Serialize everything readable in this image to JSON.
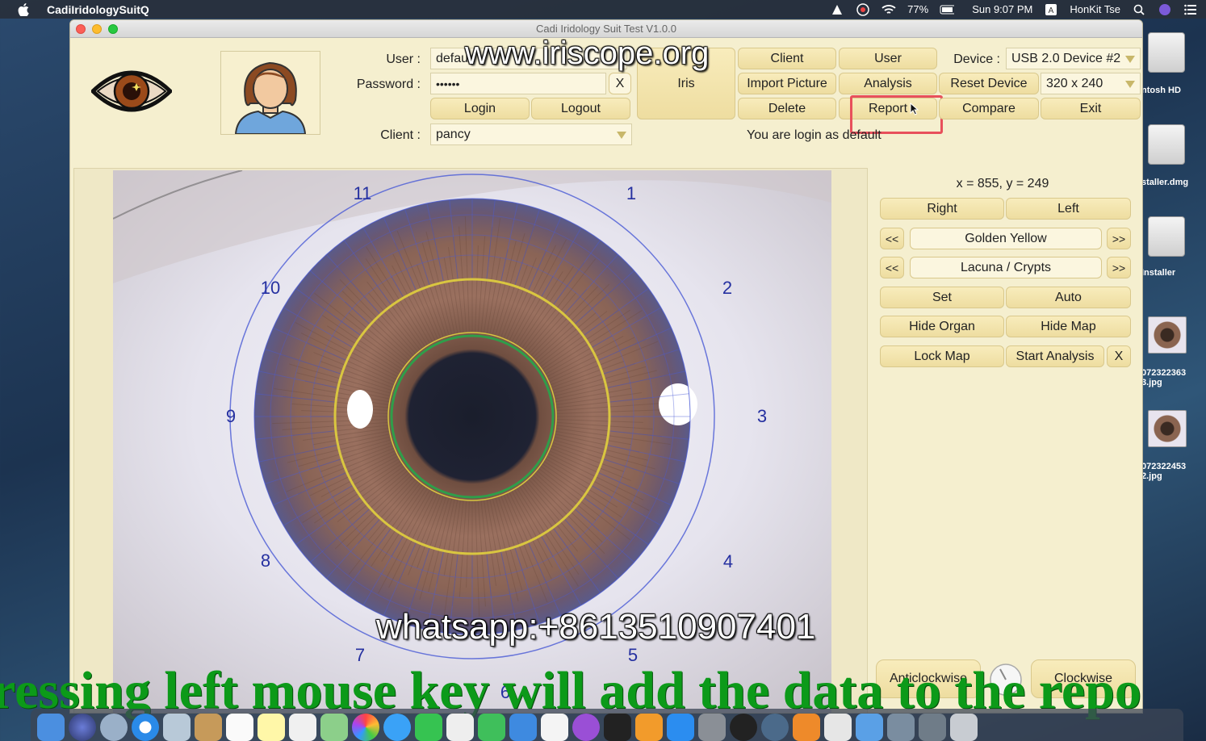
{
  "menubar": {
    "app_name": "CadiIridologySuitQ",
    "battery": "77%",
    "clock": "Sun 9:07 PM",
    "user": "HonKit Tse"
  },
  "desktop": {
    "items": [
      {
        "label": "ntosh HD",
        "icon": "hard-drive-icon"
      },
      {
        "label": "staller.dmg",
        "icon": "disk-image-icon"
      },
      {
        "label": "Installer",
        "icon": "installer-icon"
      },
      {
        "label": "072322363\n3.jpg",
        "icon": "eye-photo-icon"
      },
      {
        "label": "072322453\n2.jpg",
        "icon": "eye-photo-icon"
      }
    ]
  },
  "window": {
    "title": "Cadi Iridology Suit Test V1.0.0",
    "user_label": "User :",
    "user_value": "default",
    "password_label": "Password :",
    "password_value": "••••••",
    "clear_password": "X",
    "login": "Login",
    "logout": "Logout",
    "client_label": "Client :",
    "client_value": "pancy",
    "iris_button": "Iris",
    "client_button": "Client",
    "user_button": "User",
    "import_picture": "Import Picture",
    "analysis": "Analysis",
    "delete": "Delete",
    "report": "Report",
    "compare": "Compare",
    "exit": "Exit",
    "device_label": "Device :",
    "device_value": "USB 2.0 Device #2",
    "reset_device": "Reset Device",
    "resolution_value": "320 x 240",
    "login_status": "You are login as default"
  },
  "iris_map": {
    "clock_numbers": [
      "11",
      "1",
      "10",
      "2",
      "9",
      "3",
      "8",
      "4",
      "7",
      "5",
      "6"
    ]
  },
  "controls": {
    "coordinates": "x = 855, y = 249",
    "right": "Right",
    "left": "Left",
    "prev": "<<",
    "next": ">>",
    "category": "Golden Yellow",
    "sign": "Lacuna / Crypts",
    "set": "Set",
    "auto": "Auto",
    "hide_organ": "Hide Organ",
    "hide_map": "Hide Map",
    "lock_map": "Lock Map",
    "start_analysis": "Start Analysis",
    "close_x": "X",
    "anticlockwise": "Anticlockwise",
    "clockwise": "Clockwise"
  },
  "overlays": {
    "website": "www.iriscope.org",
    "whatsapp": "whatsapp:+8613510907401",
    "caption": "ressing left mouse key will add  the data to the repo"
  },
  "colors": {
    "window_bg": "#f5efcf",
    "button_bg": "#f3e4ae",
    "highlight": "#e8505b",
    "caption_green": "#0c9a19",
    "map_line": "#4a5bd6",
    "pupil_ring": "#d9c640"
  }
}
